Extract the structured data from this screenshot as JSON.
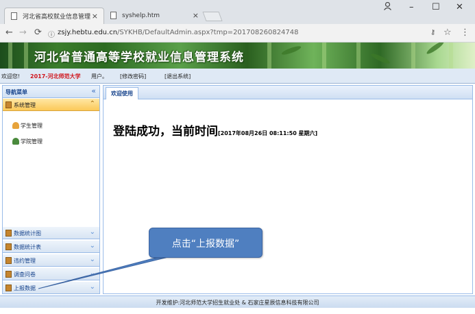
{
  "browser": {
    "tabs": [
      {
        "title": "河北省高校就业信息管理",
        "close": "×"
      },
      {
        "title": "syshelp.htm",
        "close": "×"
      }
    ],
    "url_host": "zsjy.hebtu.edu.cn",
    "url_path": "/SYKHB/DefaultAdmin.aspx?tmp=201708260824748",
    "window_controls": [
      "–",
      "☐",
      "✕"
    ],
    "nav_icons": [
      "back-icon",
      "forward-icon",
      "reload-icon"
    ]
  },
  "app": {
    "title": "河北省普通高等学校就业信息管理系统"
  },
  "userbar": {
    "welcome": "欢迎您!",
    "school": "2017-河北师范大学",
    "user": "用户。",
    "change_password": "[修改密码]",
    "logout": "[退出系统]"
  },
  "sidebar": {
    "header": "导航菜单",
    "collapse_glyph": "«",
    "open_section": {
      "label": "系统管理",
      "chevron": "⌃"
    },
    "sub_items": [
      {
        "label": "学生管理",
        "icon": "students-icon"
      },
      {
        "label": "学院管理",
        "icon": "college-icon"
      }
    ],
    "sections": [
      {
        "label": "数据统计图",
        "chevron": "⌄"
      },
      {
        "label": "数据统计表",
        "chevron": "⌄"
      },
      {
        "label": "违约管理",
        "chevron": "⌄"
      },
      {
        "label": "调查问卷",
        "chevron": "⌄"
      },
      {
        "label": "上报数据",
        "chevron": "⌄"
      }
    ]
  },
  "main": {
    "tab": "欢迎使用",
    "welcome": "登陆成功，当前时间",
    "time": "[2017年08月26日 08:11:50 星期六]"
  },
  "footer": {
    "text": "开发维护:河北师范大学招生就业处 & 石家庄星辰信息科技有限公司"
  },
  "callout": {
    "text": "点击“上报数据”"
  },
  "colors": {
    "accent": "#15428b",
    "school_red": "#d0141b",
    "callout_blue": "#4f7fc0"
  }
}
